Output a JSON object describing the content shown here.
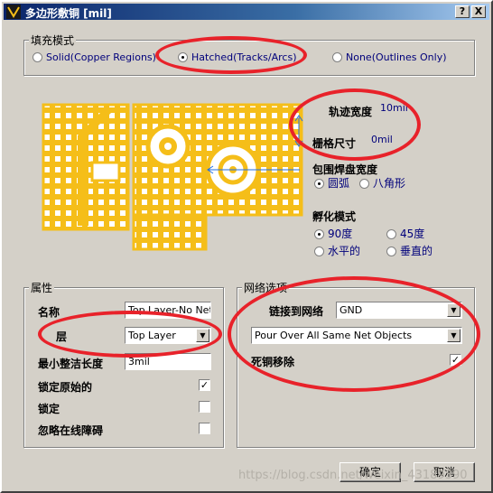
{
  "window": {
    "title": "多边形敷铜 [mil]",
    "help_label": "?",
    "close_label": "X"
  },
  "fill_mode": {
    "label": "填充模式",
    "options": [
      {
        "label": "Solid(Copper Regions)",
        "selected": false
      },
      {
        "label": "Hatched(Tracks/Arcs)",
        "selected": true
      },
      {
        "label": "None(Outlines Only)",
        "selected": false
      }
    ]
  },
  "params": {
    "track_width_label": "轨迹宽度",
    "track_width_value": "10mil",
    "grid_size_label": "栅格尺寸",
    "grid_size_value": "0mil",
    "surround_label": "包围焊盘宽度",
    "surround_options": [
      {
        "label": "圆弧",
        "selected": true
      },
      {
        "label": "八角形",
        "selected": false
      }
    ],
    "hatch_label": "孵化模式",
    "hatch_options": [
      {
        "label": "90度",
        "selected": true
      },
      {
        "label": "45度",
        "selected": false
      },
      {
        "label": "水平的",
        "selected": false
      },
      {
        "label": "垂直的",
        "selected": false
      }
    ]
  },
  "properties": {
    "label": "属性",
    "name_label": "名称",
    "name_value": "Top Layer-No Net",
    "layer_label": "层",
    "layer_value": "Top Layer",
    "min_length_label": "最小整洁长度",
    "min_length_value": "3mil",
    "lock_primitives_label": "锁定原始的",
    "lock_primitives_checked": true,
    "locked_label": "锁定",
    "locked_checked": false,
    "ignore_obstacles_label": "忽略在线障碍",
    "ignore_obstacles_checked": false
  },
  "net_options": {
    "label": "网络选项",
    "connect_label": "链接到网络",
    "connect_value": "GND",
    "pour_value": "Pour Over All Same Net Objects",
    "remove_dead_label": "死铜移除",
    "remove_dead_checked": true
  },
  "buttons": {
    "ok": "确定",
    "cancel": "取消"
  },
  "watermark": "https://blog.csdn.net/weixin_43189390",
  "colors": {
    "copper": "#f5be19",
    "annotation_red": "#e8222a",
    "dimension_blue": "#1e6ee6"
  }
}
